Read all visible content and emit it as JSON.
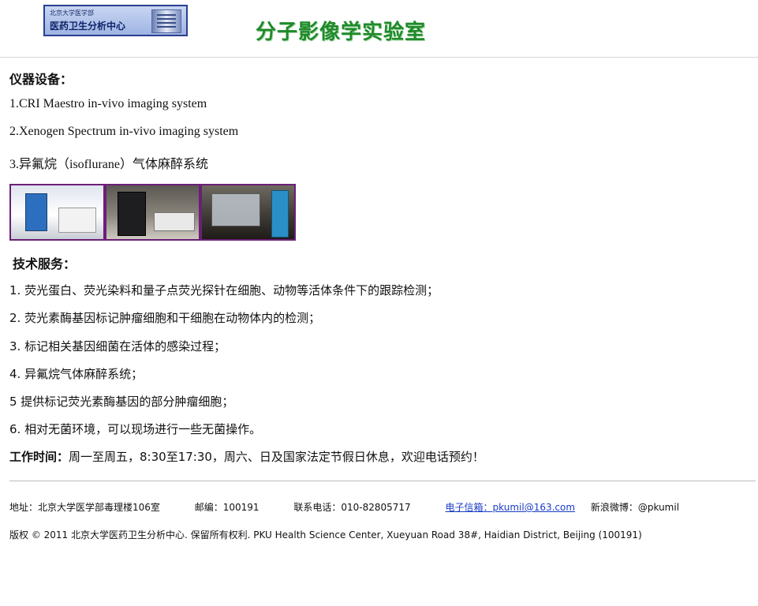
{
  "header": {
    "logo_top_text": "北京大学医学部",
    "logo_main_text": "医药卫生分析中心",
    "title": "分子影像学实验室"
  },
  "equipment": {
    "heading": "仪器设备：",
    "items": [
      "1.CRI Maestro in-vivo imaging system",
      "2.Xenogen Spectrum in-vivo imaging system",
      "3.异氟烷（isoflurane）气体麻醉系统"
    ]
  },
  "services": {
    "heading": "技术服务：",
    "items": [
      "1. 荧光蛋白、荧光染料和量子点荧光探针在细胞、动物等活体条件下的跟踪检测；",
      "2. 荧光素酶基因标记肿瘤细胞和干细胞在动物体内的检测；",
      "3. 标记相关基因细菌在活体的感染过程；",
      "4. 异氟烷气体麻醉系统；",
      "5 提供标记荧光素酶基因的部分肿瘤细胞；",
      "6. 相对无菌环境，可以现场进行一些无菌操作。"
    ]
  },
  "hours": {
    "label": "工作时间：",
    "text": "周一至周五，8:30至17:30，周六、日及国家法定节假日休息，欢迎电话预约！"
  },
  "footer": {
    "address": "地址：北京大学医学部毒理楼106室",
    "postcode": "邮编：100191",
    "phone": "联系电话：010-82805717",
    "email": "电子信箱：pkumil@163.com",
    "weibo": "新浪微博：@pkumil",
    "copyright": "版权  © 2011 北京大学医药卫生分析中心. 保留所有权利. PKU Health Science Center, Xueyuan Road 38#, Haidian District, Beijing (100191)"
  },
  "colors": {
    "title_green": "#1f8a2a",
    "photo_border": "#6b1f78",
    "link_blue": "#1a3cc7"
  }
}
